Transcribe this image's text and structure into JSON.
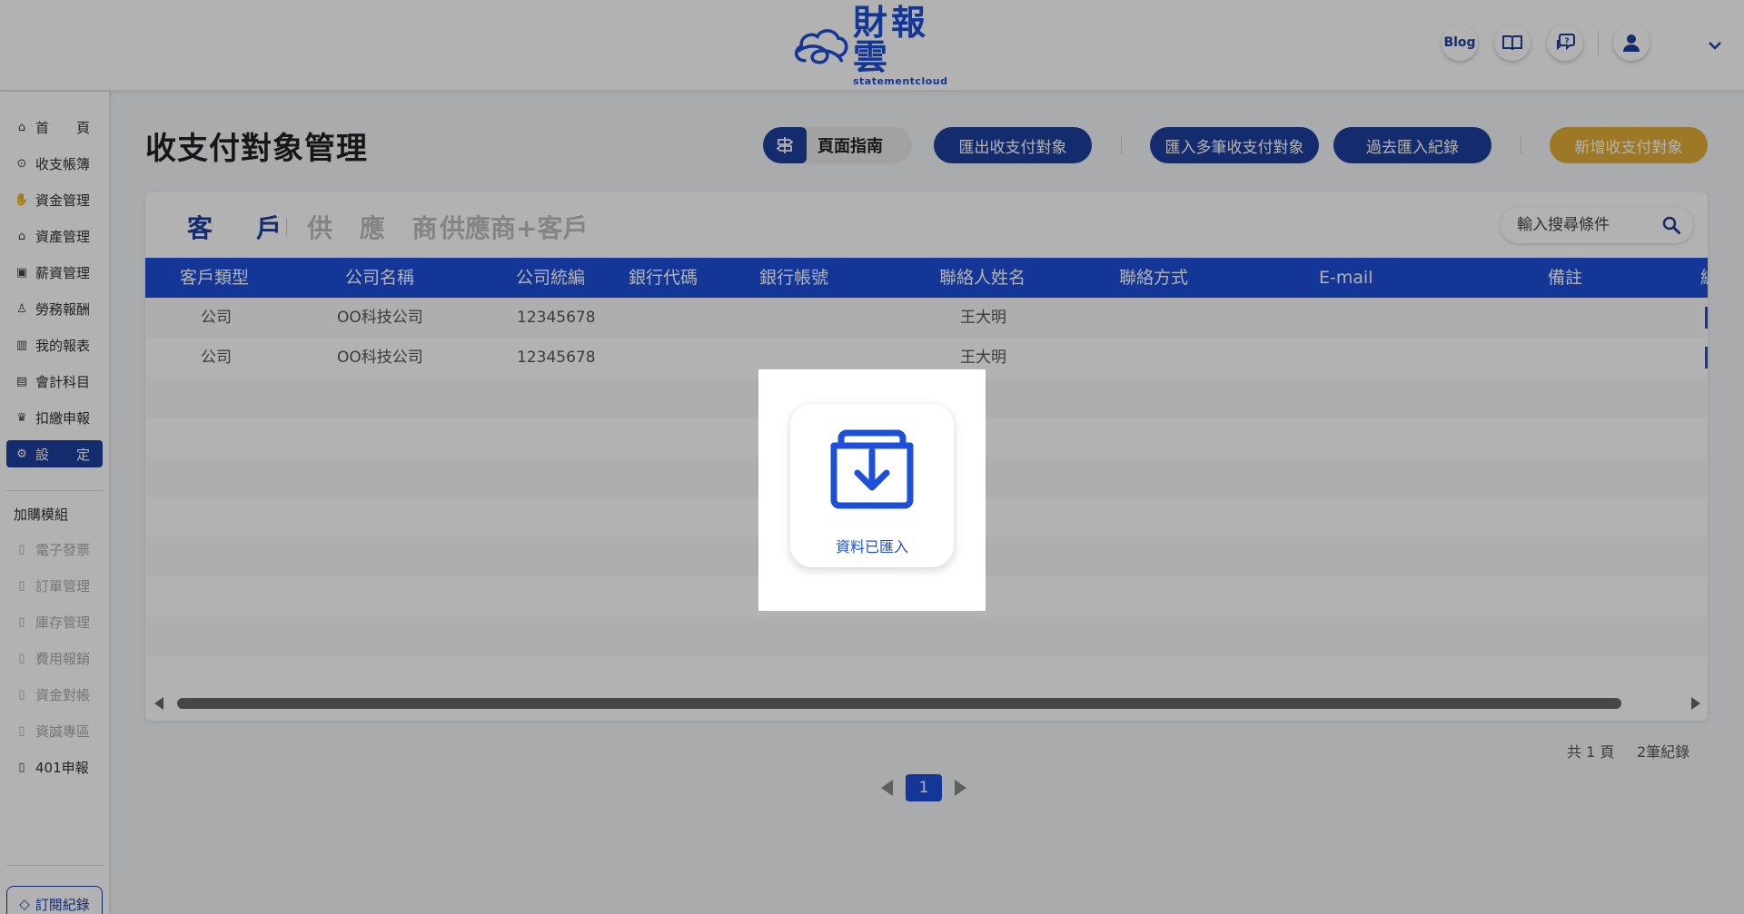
{
  "header": {
    "logo_cn": "財報雲",
    "logo_en": "statementcloud",
    "blog_label": "Blog"
  },
  "sidebar": {
    "items": [
      {
        "label": "首　　頁",
        "icon": "home-icon"
      },
      {
        "label": "收支帳簿",
        "icon": "coin-icon"
      },
      {
        "label": "資金管理",
        "icon": "money-hand-icon"
      },
      {
        "label": "資產管理",
        "icon": "asset-icon"
      },
      {
        "label": "薪資管理",
        "icon": "salary-icon"
      },
      {
        "label": "勞務報酬",
        "icon": "labor-icon"
      },
      {
        "label": "我的報表",
        "icon": "report-icon"
      },
      {
        "label": "會計科目",
        "icon": "ledger-icon"
      },
      {
        "label": "扣繳申報",
        "icon": "tax-icon"
      },
      {
        "label": "設　　定",
        "icon": "settings-icon"
      }
    ],
    "addon_title": "加購模組",
    "addons": [
      "電子發票",
      "訂單管理",
      "庫存管理",
      "費用報銷",
      "資金對帳",
      "資誠專區",
      "401申報"
    ],
    "subscription_label": "訂閱紀錄"
  },
  "page": {
    "title": "收支付對象管理",
    "guide_label": "頁面指南",
    "export_label": "匯出收支付對象",
    "import_multi_label": "匯入多筆收支付對象",
    "import_history_label": "過去匯入紀錄",
    "add_label": "新增收支付對象"
  },
  "tabs": [
    "客　戶",
    "供 應 商",
    "供應商+客戶"
  ],
  "search": {
    "placeholder": "輸入搜尋條件"
  },
  "table": {
    "columns": [
      "客戶類型",
      "公司名稱",
      "公司統編",
      "銀行代碼",
      "銀行帳號",
      "聯絡人姓名",
      "聯絡方式",
      "E-mail",
      "備註",
      "編"
    ],
    "rows": [
      {
        "type": "公司",
        "company": "OO科技公司",
        "tax_id": "12345678",
        "contact": "王大明"
      },
      {
        "type": "公司",
        "company": "OO科技公司",
        "tax_id": "12345678",
        "contact": "王大明"
      }
    ]
  },
  "footer": {
    "pages_text": "共 1 頁",
    "records_text": "2筆紀錄",
    "current_page": "1"
  },
  "modal": {
    "message": "資料已匯入"
  },
  "colors": {
    "primary": "#1d3f9c",
    "table_header": "#1d4fd8",
    "gold": "#e1ad38"
  }
}
